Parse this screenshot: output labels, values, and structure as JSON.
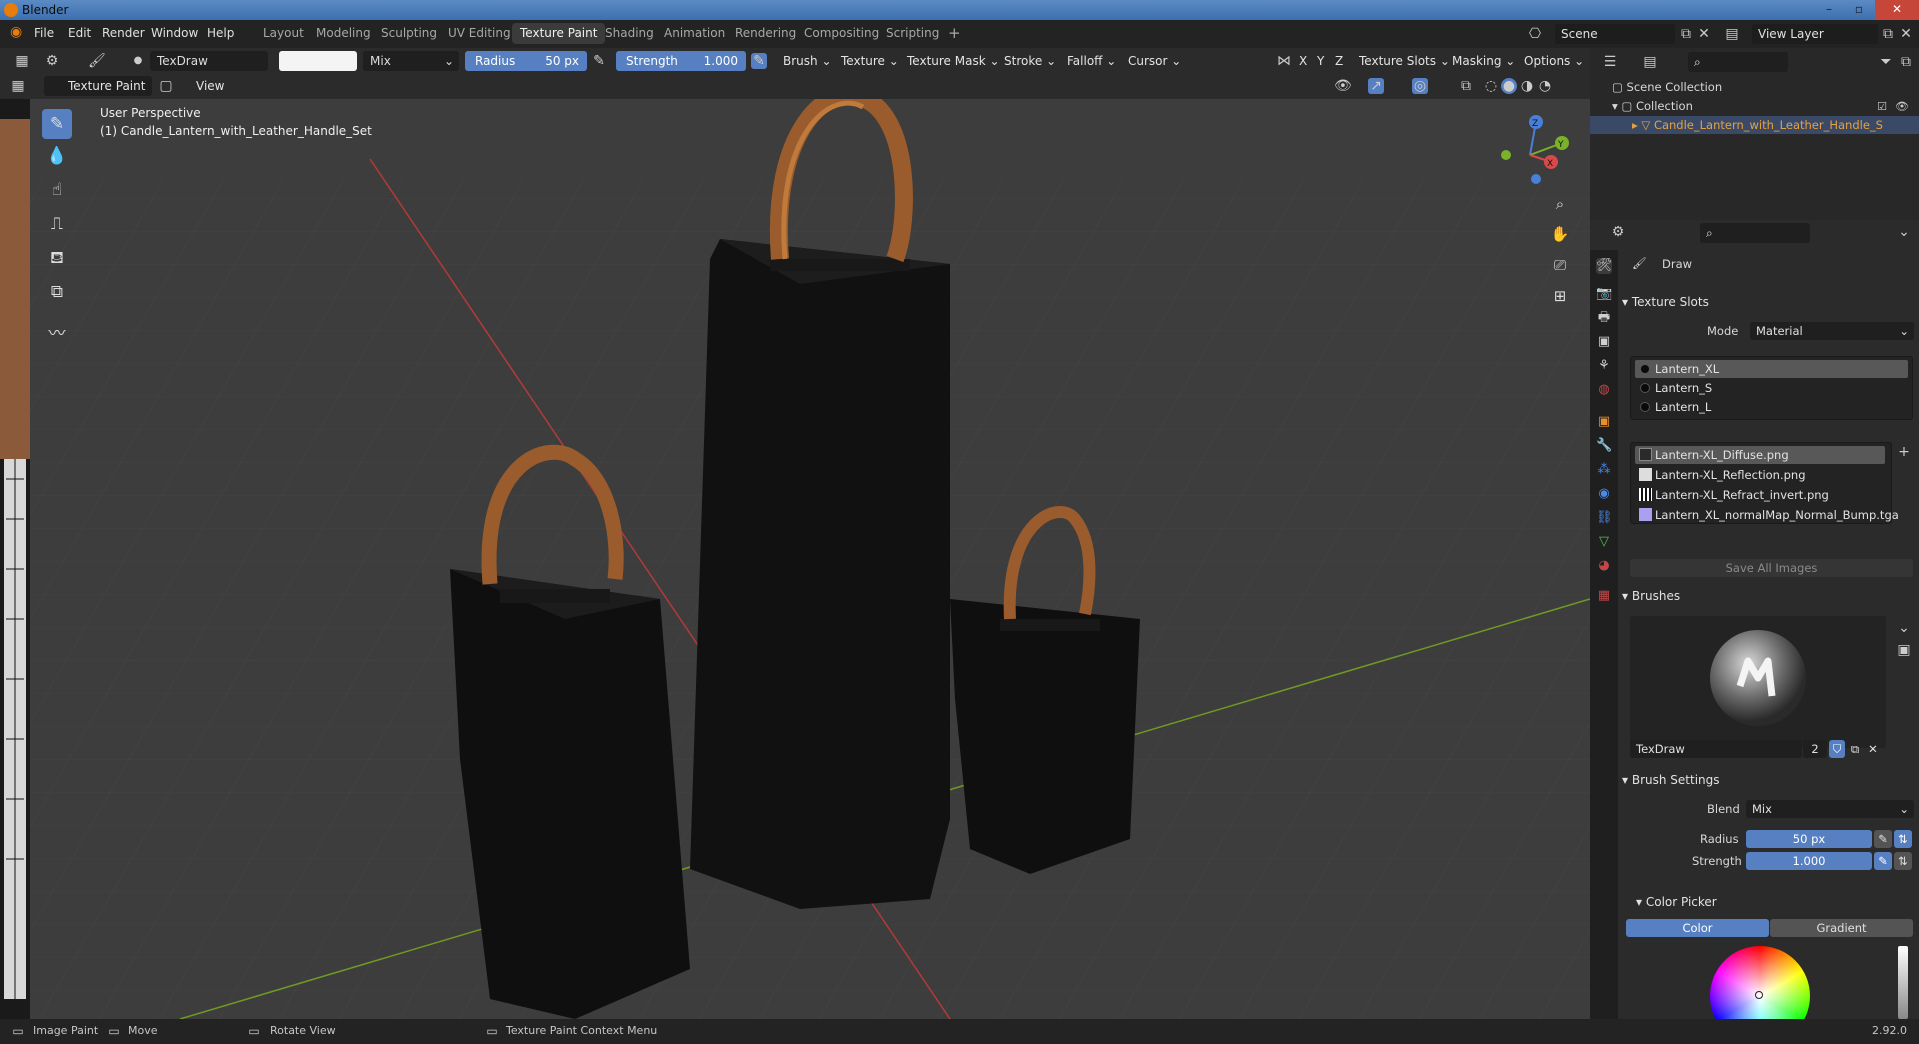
{
  "window": {
    "title": "Blender",
    "version": "2.92.0"
  },
  "menu": [
    "File",
    "Edit",
    "Render",
    "Window",
    "Help"
  ],
  "workspaces": [
    "Layout",
    "Modeling",
    "Sculpting",
    "UV Editing",
    "Texture Paint",
    "Shading",
    "Animation",
    "Rendering",
    "Compositing",
    "Scripting"
  ],
  "active_workspace": "Texture Paint",
  "scene": "Scene",
  "view_layer": "View Layer",
  "tool_header": {
    "brush_name": "TexDraw",
    "blend": "Mix",
    "radius_label": "Radius",
    "radius_value": "50 px",
    "strength_label": "Strength",
    "strength_value": "1.000",
    "dropdowns": [
      "Brush",
      "Texture",
      "Texture Mask",
      "Stroke",
      "Falloff",
      "Cursor"
    ],
    "axis": [
      "X",
      "Y",
      "Z"
    ],
    "right_dropdowns": [
      "Texture Slots",
      "Masking",
      "Options"
    ]
  },
  "mode_header": {
    "mode": "Texture Paint",
    "view": "View"
  },
  "viewport": {
    "perspective": "User Perspective",
    "object": "(1) Candle_Lantern_with_Leather_Handle_Set",
    "gizmo": {
      "x": "X",
      "y": "Y",
      "z": "Z"
    }
  },
  "outliner": {
    "scene_collection": "Scene Collection",
    "collection": "Collection",
    "object": "Candle_Lantern_with_Leather_Handle_S"
  },
  "properties": {
    "tool": "Draw",
    "texture_slots_title": "Texture Slots",
    "mode_label": "Mode",
    "mode_value": "Material",
    "materials": [
      "Lantern_XL",
      "Lantern_S",
      "Lantern_L"
    ],
    "images": [
      "Lantern-XL_Diffuse.png",
      "Lantern-XL_Reflection.png",
      "Lantern-XL_Refract_invert.png",
      "Lantern_XL_normalMap_Normal_Bump.tga"
    ],
    "save_all": "Save All Images",
    "brushes_title": "Brushes",
    "brush_name": "TexDraw",
    "brush_users": "2",
    "brush_settings_title": "Brush Settings",
    "blend_label": "Blend",
    "blend_value": "Mix",
    "radius_label": "Radius",
    "radius_value": "50 px",
    "strength_label": "Strength",
    "strength_value": "1.000",
    "color_picker_title": "Color Picker",
    "color_tab": "Color",
    "gradient_tab": "Gradient"
  },
  "status": {
    "left": "Image Paint",
    "move": "Move",
    "rotate": "Rotate View",
    "context": "Texture Paint Context Menu"
  },
  "colors": {
    "accent": "#5680c2",
    "orange": "#e87d0d",
    "grid_x": "#b33a3a",
    "grid_y": "#7aa02a"
  },
  "icons": [
    "blender-logo",
    "brush-icon",
    "draw-icon",
    "soften-icon",
    "smear-icon",
    "clone-icon",
    "fill-icon",
    "mask-icon",
    "annotate-icon",
    "zoom-icon",
    "hand-icon",
    "camera-icon",
    "grid-icon"
  ]
}
